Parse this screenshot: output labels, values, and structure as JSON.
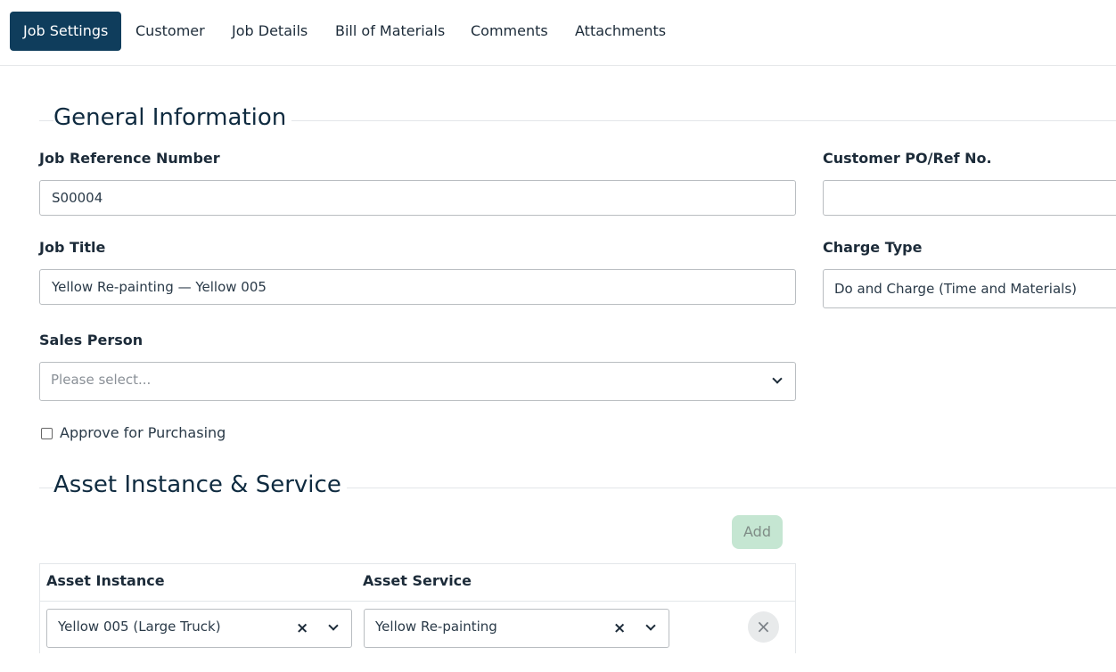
{
  "tabs": [
    {
      "label": "Job Settings",
      "active": true
    },
    {
      "label": "Customer"
    },
    {
      "label": "Job Details"
    },
    {
      "label": "Bill of Materials"
    },
    {
      "label": "Comments"
    },
    {
      "label": "Attachments"
    }
  ],
  "general": {
    "title": "General Information",
    "job_ref_label": "Job Reference Number",
    "job_ref_value": "S00004",
    "customer_po_label": "Customer PO/Ref No.",
    "customer_po_value": "",
    "job_title_label": "Job Title",
    "job_title_value": "Yellow Re-painting — Yellow 005",
    "charge_type_label": "Charge Type",
    "charge_type_value": "Do and Charge (Time and Materials)",
    "sales_person_label": "Sales Person",
    "sales_person_placeholder": "Please select...",
    "approve_label": "Approve for Purchasing",
    "approve_checked": false
  },
  "asset": {
    "title": "Asset Instance & Service",
    "add_label": "Add",
    "col_instance": "Asset Instance",
    "col_service": "Asset Service",
    "rows": [
      {
        "instance": "Yellow 005 (Large Truck)",
        "service": "Yellow Re-painting"
      }
    ],
    "clear_glyph": "×",
    "remove_glyph": "×"
  },
  "colors": {
    "tab_active_bg": "#0f3d5c",
    "add_button_bg": "#c5e6d2"
  }
}
